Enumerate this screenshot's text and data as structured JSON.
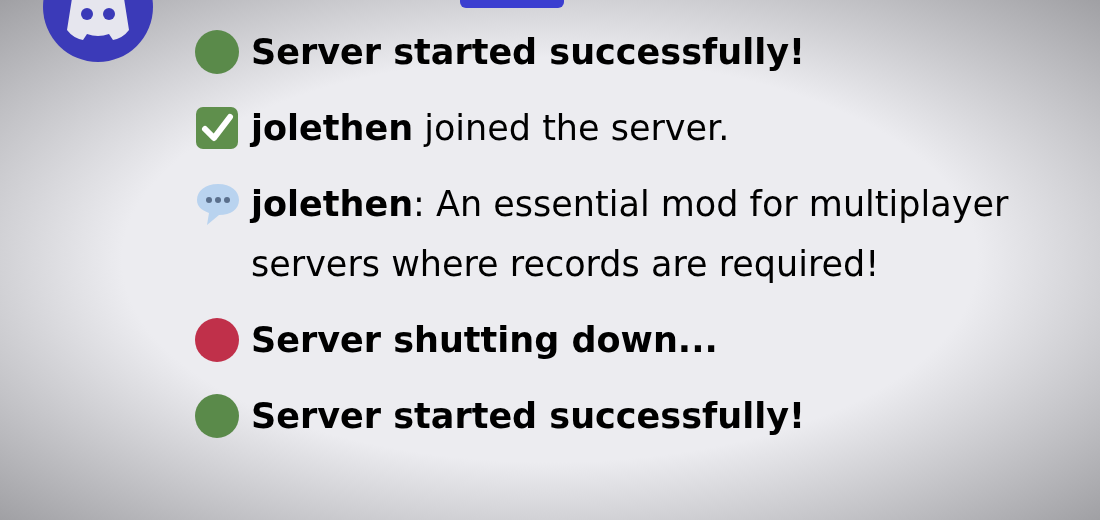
{
  "messages": [
    {
      "kind": "status",
      "color": "#5a8a4a",
      "text": "Server started successfully!"
    },
    {
      "kind": "join",
      "text": "**jolethen** joined the server."
    },
    {
      "kind": "chat",
      "text": "**jolethen**: An essential mod for multiplayer servers where records are required!"
    },
    {
      "kind": "status",
      "color": "#c0304a",
      "text": "Server shutting down..."
    },
    {
      "kind": "status",
      "color": "#5a8a4a",
      "text": "Server started successfully!"
    }
  ]
}
